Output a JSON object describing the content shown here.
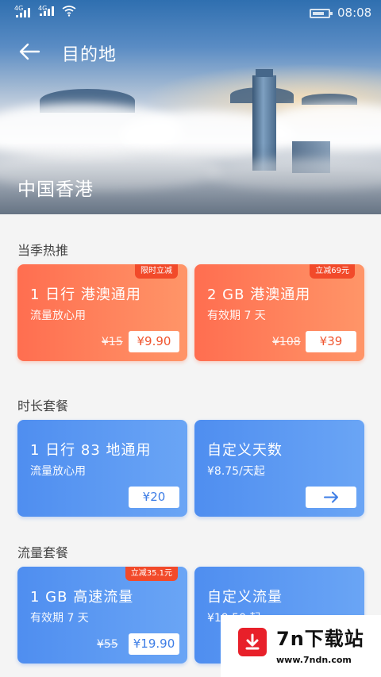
{
  "status": {
    "sim1": "4G",
    "sim2": "4G",
    "time": "08:08"
  },
  "header": {
    "title": "目的地",
    "destination": "中国香港"
  },
  "sections": [
    {
      "title": "当季热推",
      "cards": [
        {
          "title": "1 日行  港澳通用",
          "subtitle": "流量放心用",
          "badge": "限时立减",
          "old_price": "¥15",
          "price": "¥9.90"
        },
        {
          "title": "2 GB 港澳通用",
          "subtitle": "有效期 7 天",
          "badge": "立减69元",
          "old_price": "¥108",
          "price": "¥39"
        }
      ]
    },
    {
      "title": "时长套餐",
      "cards": [
        {
          "title": "1 日行  83 地通用",
          "subtitle": "流量放心用",
          "price": "¥20"
        },
        {
          "title": "自定义天数",
          "subtitle": "¥8.75/天起"
        }
      ]
    },
    {
      "title": "流量套餐",
      "cards": [
        {
          "title": "1 GB 高速流量",
          "subtitle": "有效期 7 天",
          "badge": "立减35.1元",
          "old_price": "¥55",
          "price": "¥19.90"
        },
        {
          "title": "自定义流量",
          "subtitle": "¥19.50 起"
        }
      ]
    }
  ],
  "watermark": {
    "name": "7n下载站",
    "url": "www.7ndn.com"
  },
  "colors": {
    "orange_start": "#ff6e50",
    "orange_end": "#ff9568",
    "blue_start": "#4f8ef0",
    "blue_end": "#6aa5f5",
    "badge": "#f24a2a"
  }
}
